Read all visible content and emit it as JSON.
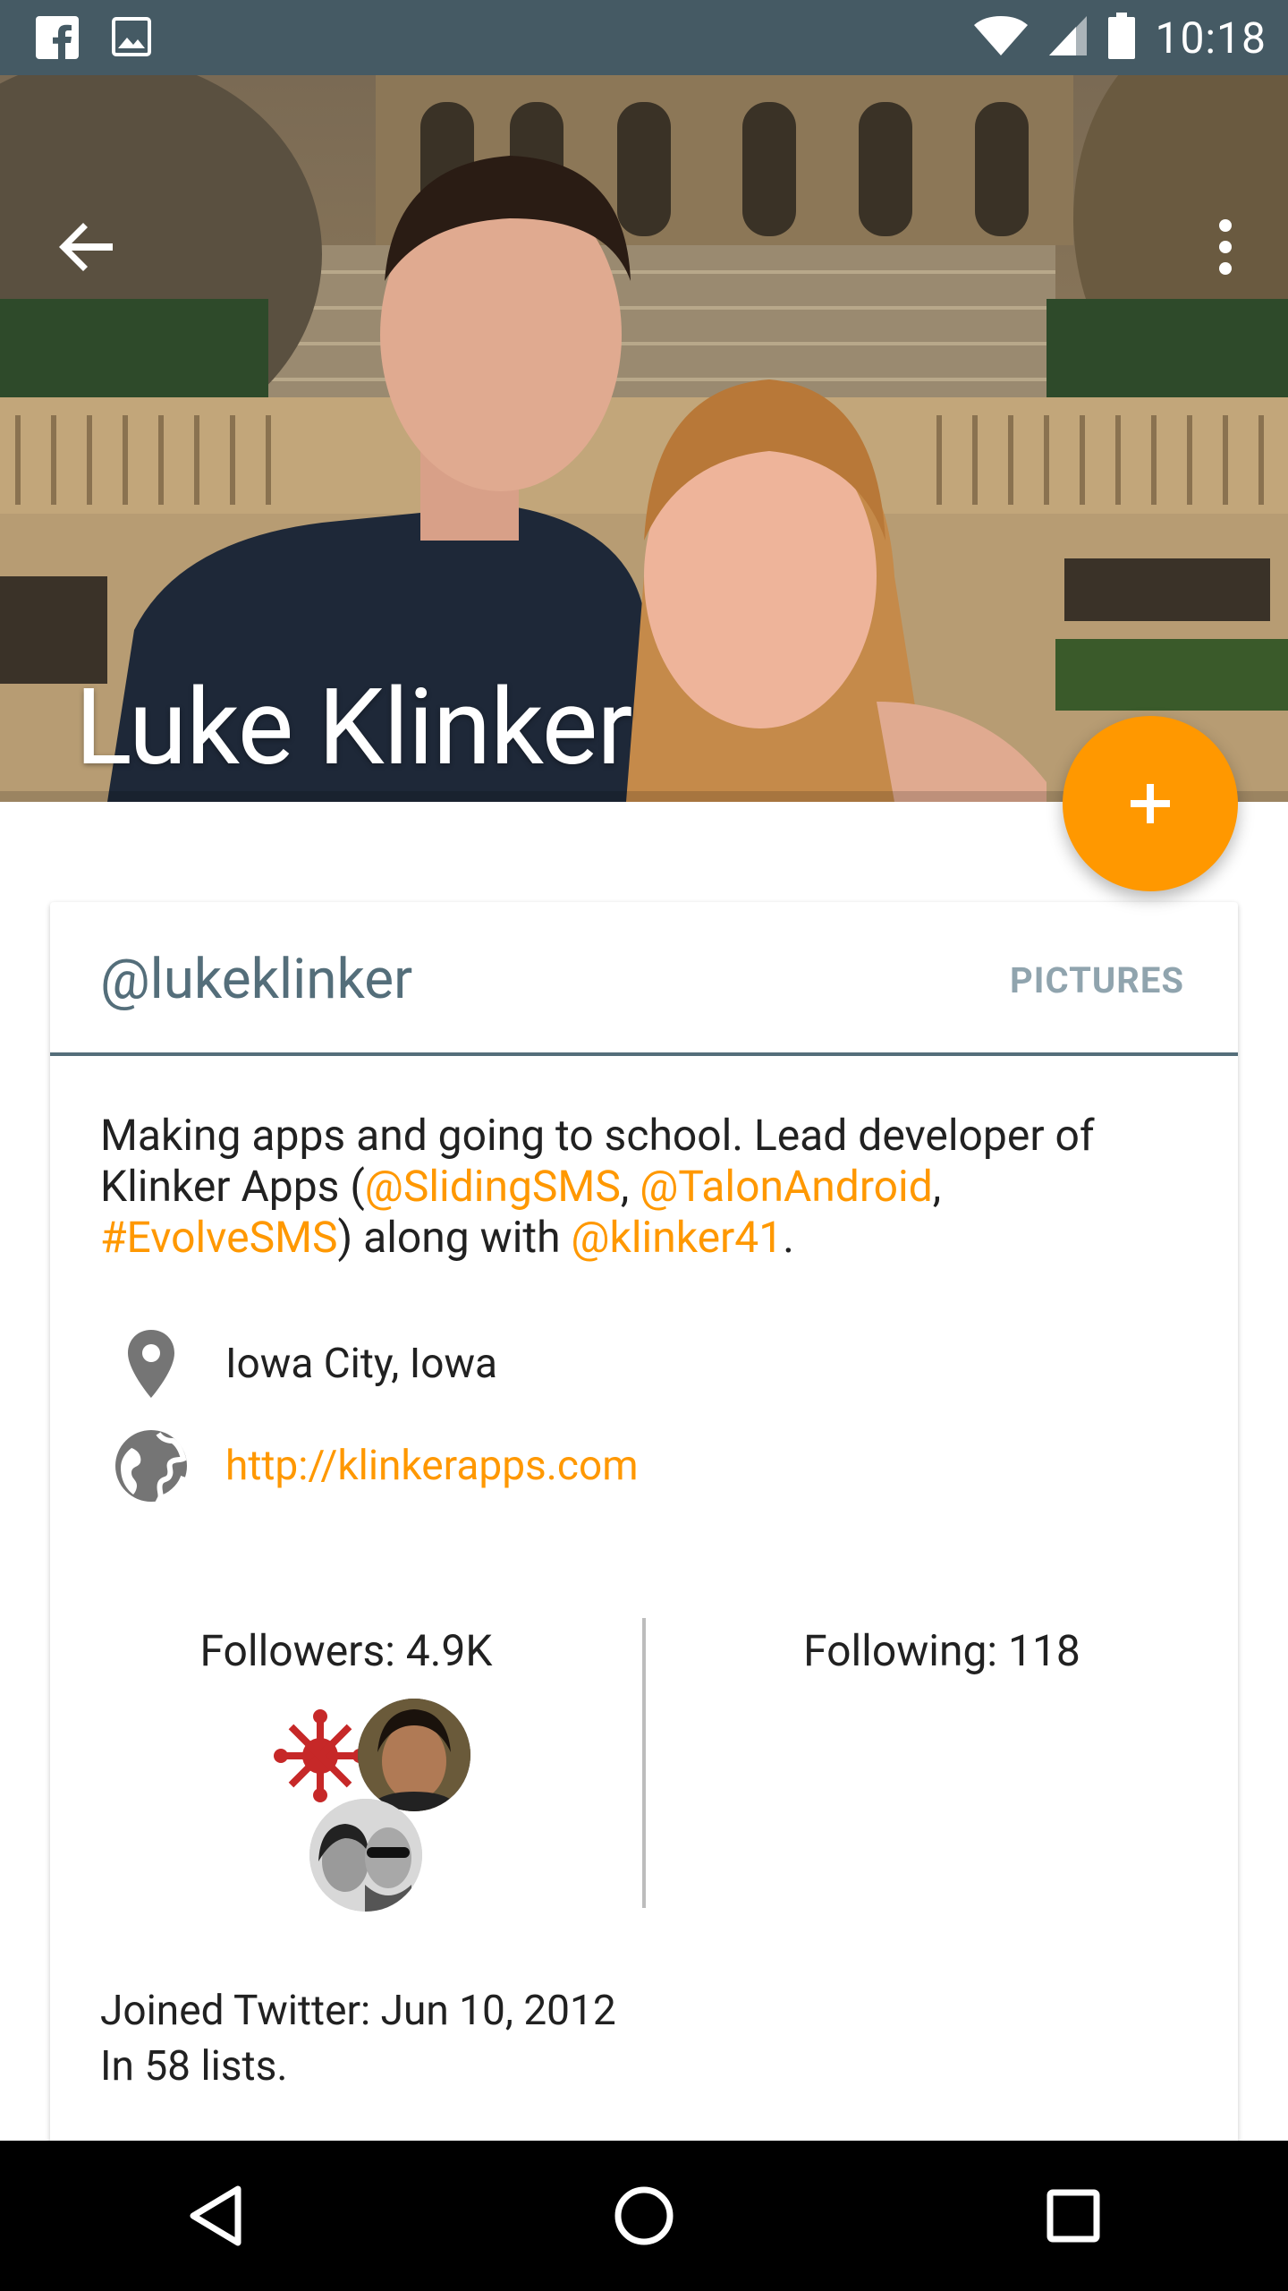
{
  "status_bar": {
    "time": "10:18",
    "icons": [
      "facebook-icon",
      "image-icon",
      "wifi-icon",
      "cell-signal-icon",
      "battery-icon"
    ]
  },
  "header": {
    "name": "Luke Klinker",
    "back_icon": "arrow-back-icon",
    "menu_icon": "more-vert-icon"
  },
  "fab": {
    "icon": "plus-icon",
    "color": "#ff9800"
  },
  "card": {
    "handle": "@lukeklinker",
    "tab_pictures": "PICTURES",
    "bio": {
      "part1": "Making apps and going to school. Lead developer of Klinker Apps (",
      "link1": "@SlidingSMS",
      "sep1": ", ",
      "link2": "@TalonAndroid",
      "sep2": ", ",
      "link3": "#EvolveSMS",
      "part2": ") along with ",
      "link4": "@klinker41",
      "part3": "."
    },
    "location": "Iowa City, Iowa",
    "website": "http://klinkerapps.com",
    "followers": "Followers: 4.9K",
    "following": "Following: 118",
    "joined": "Joined Twitter: Jun 10, 2012",
    "lists": "In 58 lists."
  },
  "colors": {
    "status_bar": "#455a64",
    "accent": "#ff9800",
    "handle": "#546e7a",
    "tab_inactive": "#90a4ae"
  },
  "nav_bar": {
    "icons": [
      "back-triangle-icon",
      "home-circle-icon",
      "recents-square-icon"
    ]
  }
}
